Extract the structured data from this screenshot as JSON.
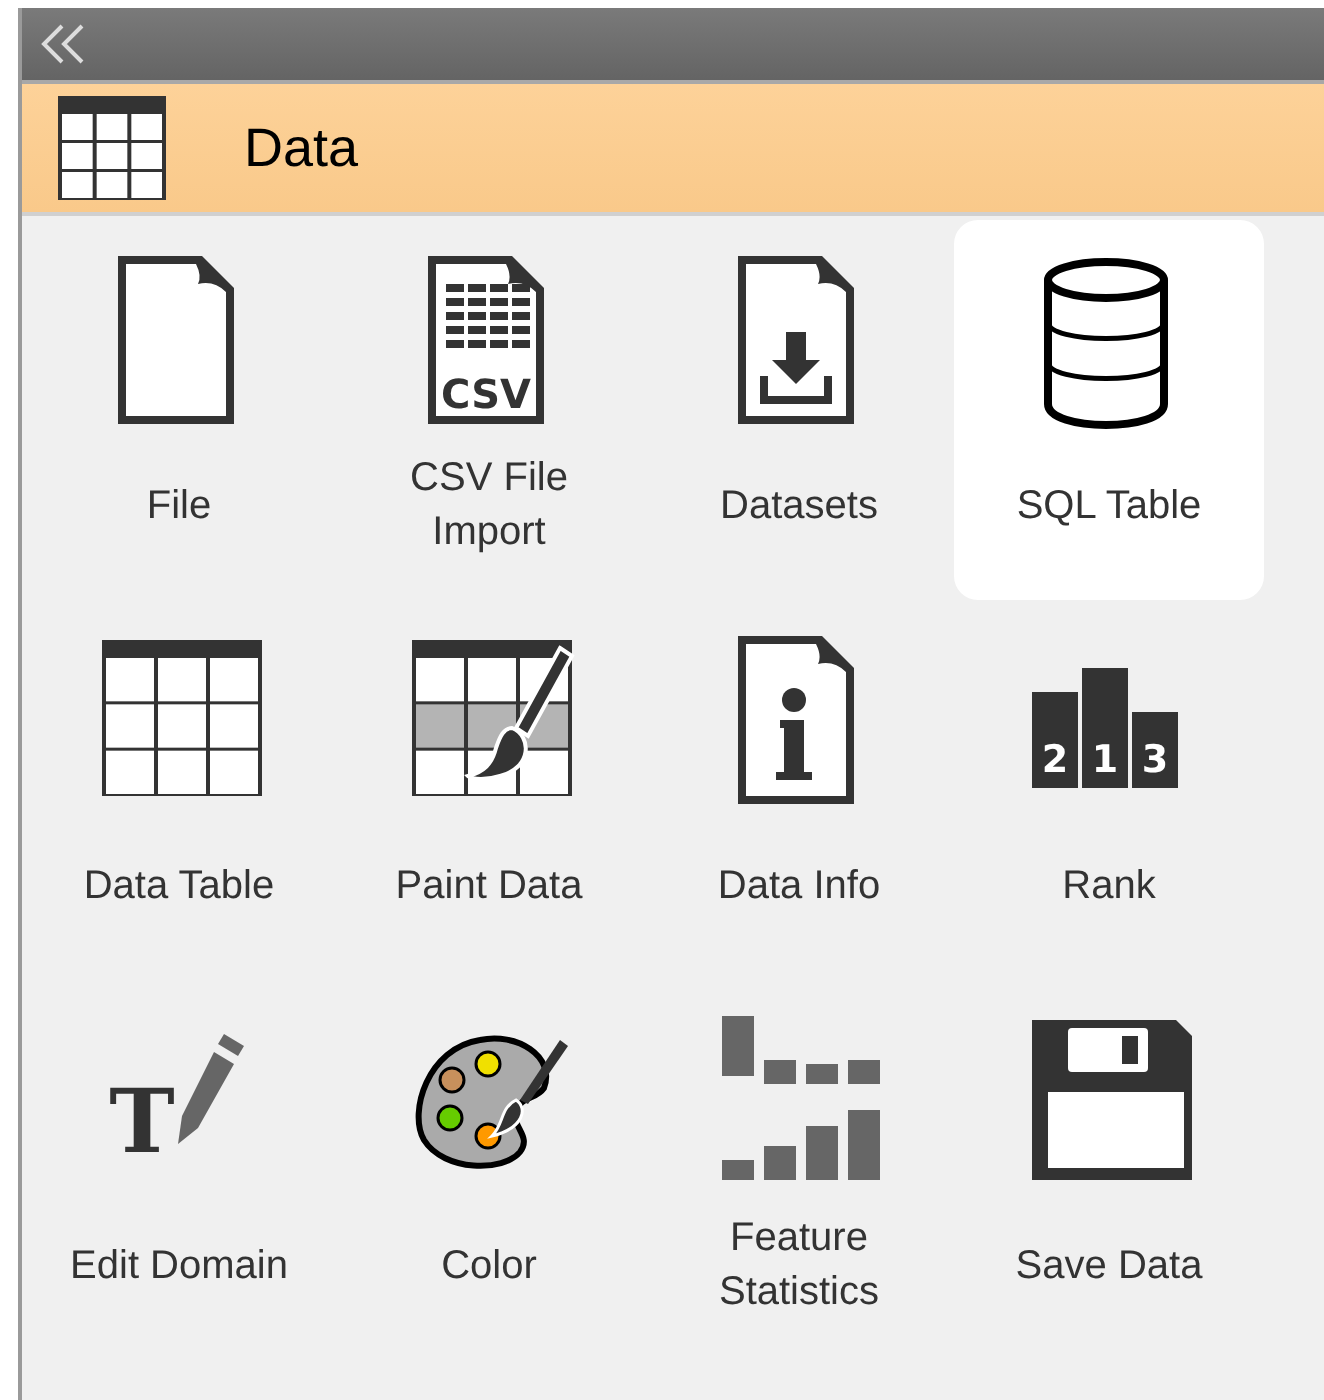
{
  "panel": {
    "title": "Data"
  },
  "widgets": [
    {
      "label": "File",
      "kind": "file",
      "selected": false
    },
    {
      "label": "CSV File Import",
      "kind": "csv",
      "icon_text": "CSV",
      "selected": false
    },
    {
      "label": "Datasets",
      "kind": "datasets",
      "selected": false
    },
    {
      "label": "SQL Table",
      "kind": "database",
      "selected": true
    },
    {
      "label": "Data Table",
      "kind": "table",
      "selected": false
    },
    {
      "label": "Paint Data",
      "kind": "paint",
      "selected": false
    },
    {
      "label": "Data Info",
      "kind": "info",
      "selected": false
    },
    {
      "label": "Rank",
      "kind": "rank",
      "icon_text": "2 1 3",
      "selected": false
    },
    {
      "label": "Edit Domain",
      "kind": "edit",
      "icon_text": "T",
      "selected": false
    },
    {
      "label": "Color",
      "kind": "palette",
      "selected": false
    },
    {
      "label": "Feature Statistics",
      "kind": "stats",
      "selected": false
    },
    {
      "label": "Save Data",
      "kind": "save",
      "selected": false
    }
  ]
}
